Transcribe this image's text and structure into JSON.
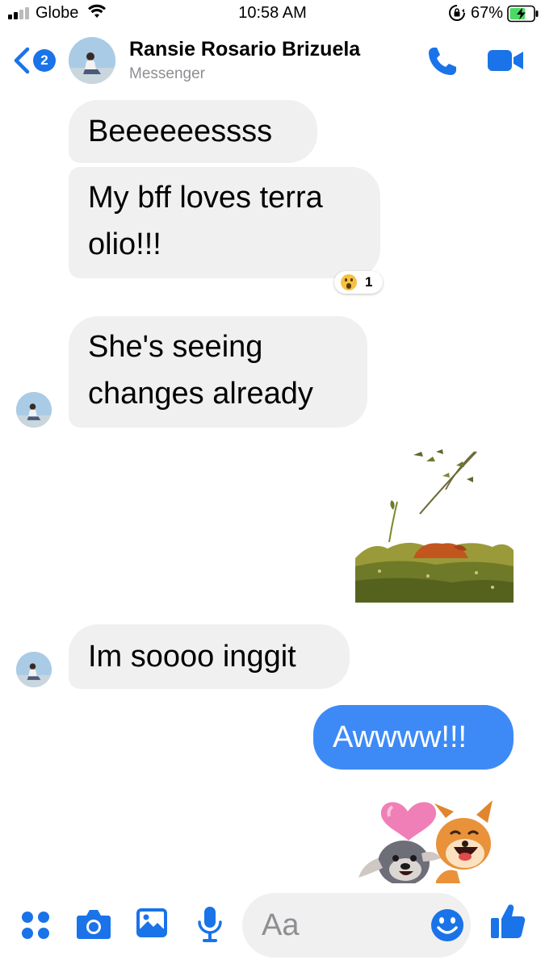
{
  "status_bar": {
    "carrier": "Globe",
    "time": "10:58 AM",
    "battery_percent": "67%",
    "battery_level": 0.67,
    "icons": [
      "signal-icon",
      "wifi-icon",
      "orientation-lock-icon",
      "battery-charging-icon"
    ]
  },
  "header": {
    "back_badge": "2",
    "contact_name": "Ransie Rosario Brizuela",
    "subtitle": "Messenger",
    "icons": [
      "back-chevron-icon",
      "phone-icon",
      "video-camera-icon"
    ]
  },
  "messages": [
    {
      "direction": "incoming",
      "text": "Beeeeeessss"
    },
    {
      "direction": "incoming",
      "text": "My bff loves terra olio!!!",
      "reaction": {
        "emoji": "surprised-face",
        "count": "1"
      }
    },
    {
      "direction": "incoming",
      "text": "She's seeing changes already"
    },
    {
      "direction": "outgoing",
      "type": "sticker",
      "sticker": "fox-in-windy-field"
    },
    {
      "direction": "incoming",
      "text": "Im soooo inggit"
    },
    {
      "direction": "outgoing",
      "text": "Awwww!!!"
    },
    {
      "direction": "outgoing",
      "type": "sticker",
      "sticker": "fox-and-pug-with-heart"
    }
  ],
  "composer": {
    "placeholder": "Aa",
    "icons": [
      "grid-dots-icon",
      "camera-icon",
      "photo-gallery-icon",
      "microphone-icon",
      "emoji-icon",
      "thumbs-up-icon"
    ]
  },
  "colors": {
    "accent": "#1a73e8",
    "outgoing_bubble": "#3d8af7",
    "incoming_bubble": "#f0f0f0",
    "battery_green": "#4cd964"
  }
}
